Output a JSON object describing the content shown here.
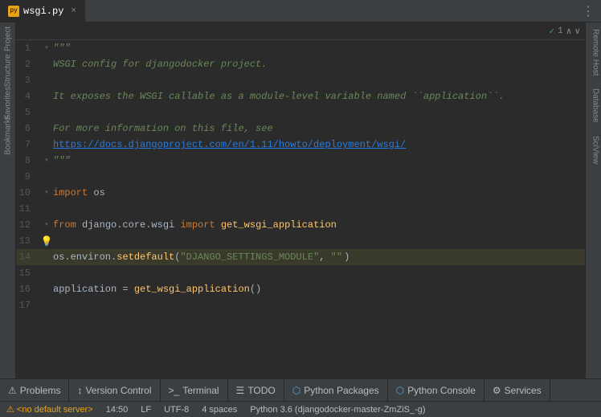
{
  "tab": {
    "icon": "py",
    "label": "wsgi.py",
    "close": "×"
  },
  "more_icon": "⋮",
  "editor_nav": {
    "check_icon": "✓",
    "count": "1",
    "up_arrow": "∧",
    "down_arrow": "∨"
  },
  "lines": [
    {
      "num": 1,
      "content": "\"\"\"",
      "type": "string",
      "gutter": "fold"
    },
    {
      "num": 2,
      "content": "WSGI config for djangodocker project.",
      "type": "string",
      "gutter": ""
    },
    {
      "num": 3,
      "content": "",
      "type": "normal",
      "gutter": ""
    },
    {
      "num": 4,
      "content": "It exposes the WSGI callable as a module-level variable named ``application``.",
      "type": "string",
      "gutter": ""
    },
    {
      "num": 5,
      "content": "",
      "type": "normal",
      "gutter": ""
    },
    {
      "num": 6,
      "content": "For more information on this file, see",
      "type": "string",
      "gutter": ""
    },
    {
      "num": 7,
      "content": "https://docs.djangoproject.com/en/1.11/howto/deployment/wsgi/",
      "type": "link",
      "gutter": ""
    },
    {
      "num": 8,
      "content": "\"\"\"",
      "type": "string",
      "gutter": "fold"
    },
    {
      "num": 9,
      "content": "",
      "type": "normal",
      "gutter": ""
    },
    {
      "num": 10,
      "content": "import os",
      "type": "import",
      "gutter": "fold"
    },
    {
      "num": 11,
      "content": "",
      "type": "normal",
      "gutter": ""
    },
    {
      "num": 12,
      "content": "from django.core.wsgi import get_wsgi_application",
      "type": "from_import",
      "gutter": "fold"
    },
    {
      "num": 13,
      "content": "",
      "type": "bulb",
      "gutter": "bulb"
    },
    {
      "num": 14,
      "content": "os.environ.setdefault(\"DJANGO_SETTINGS_MODULE\", \"|\")",
      "type": "highlighted",
      "gutter": ""
    },
    {
      "num": 15,
      "content": "",
      "type": "normal",
      "gutter": ""
    },
    {
      "num": 16,
      "content": "application = get_wsgi_application()",
      "type": "normal",
      "gutter": ""
    },
    {
      "num": 17,
      "content": "",
      "type": "normal",
      "gutter": ""
    }
  ],
  "right_sidebar": {
    "items": [
      "Remote Host",
      "Database",
      "SciView"
    ]
  },
  "left_sidebar": {
    "items": [
      "Project",
      "Structure",
      "Favorites",
      "Bookmarks"
    ]
  },
  "bottom_toolbar": {
    "buttons": [
      {
        "icon": "⚠",
        "label": "Problems"
      },
      {
        "icon": "↕",
        "label": "Version Control"
      },
      {
        "icon": ">_",
        "label": "Terminal"
      },
      {
        "icon": "☰",
        "label": "TODO"
      },
      {
        "icon": "🐍",
        "label": "Python Packages"
      },
      {
        "icon": "🐍",
        "label": "Python Console"
      },
      {
        "icon": "⚙",
        "label": "Services"
      }
    ]
  },
  "status_bar": {
    "warning": "⚠ <no default server>",
    "time": "14:50",
    "line_ending": "LF",
    "encoding": "UTF-8",
    "indent": "4 spaces",
    "python": "Python 3.6 (djangodocker-master-ZmZiS_-g)"
  }
}
